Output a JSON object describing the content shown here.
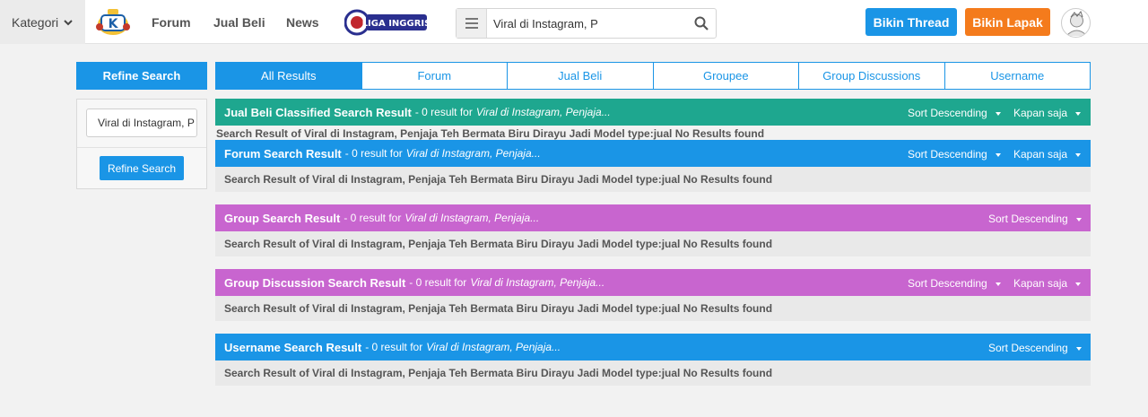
{
  "header": {
    "kategori_label": "Kategori",
    "nav": [
      "Forum",
      "Jual Beli",
      "News"
    ],
    "liga_text": "LIGA INGGRIS",
    "search_value": "Viral di Instagram, P",
    "thread_button": "Bikin Thread",
    "lapak_button": "Bikin Lapak"
  },
  "refine": {
    "heading": "Refine Search",
    "input_value": "Viral di Instagram, P",
    "button_label": "Refine Search"
  },
  "tabs": [
    "All Results",
    "Forum",
    "Jual Beli",
    "Groupee",
    "Group Discussions",
    "Username"
  ],
  "sections": [
    {
      "title": "Jual Beli Classified Search Result",
      "count": "- 0 result for",
      "query": "Viral di Instagram, Penjaja...",
      "sort": "Sort Descending",
      "time": "Kapan saja",
      "message": "Search Result of Viral di Instagram, Penjaja Teh Bermata Biru Dirayu Jadi Model type:jual No Results found",
      "color": "#1ea78f"
    },
    {
      "title": "Forum Search Result",
      "count": "- 0 result for",
      "query": "Viral di Instagram, Penjaja...",
      "sort": "Sort Descending",
      "time": "Kapan saja",
      "message": "Search Result of Viral di Instagram, Penjaja Teh Bermata Biru Dirayu Jadi Model type:jual No Results found",
      "color": "#1a95e6"
    },
    {
      "title": "Group Search Result",
      "count": "- 0 result for",
      "query": "Viral di Instagram, Penjaja...",
      "sort": "Sort Descending",
      "message": "Search Result of Viral di Instagram, Penjaja Teh Bermata Biru Dirayu Jadi Model type:jual No Results found",
      "color": "#c865cf"
    },
    {
      "title": "Group Discussion Search Result",
      "count": "- 0 result for",
      "query": "Viral di Instagram, Penjaja...",
      "sort": "Sort Descending",
      "time": "Kapan saja",
      "message": "Search Result of Viral di Instagram, Penjaja Teh Bermata Biru Dirayu Jadi Model type:jual No Results found",
      "color": "#c865cf"
    },
    {
      "title": "Username Search Result",
      "count": "- 0 result for",
      "query": "Viral di Instagram, Penjaja...",
      "sort": "Sort Descending",
      "message": "Search Result of Viral di Instagram, Penjaja Teh Bermata Biru Dirayu Jadi Model type:jual No Results found",
      "color": "#1a95e6"
    }
  ]
}
